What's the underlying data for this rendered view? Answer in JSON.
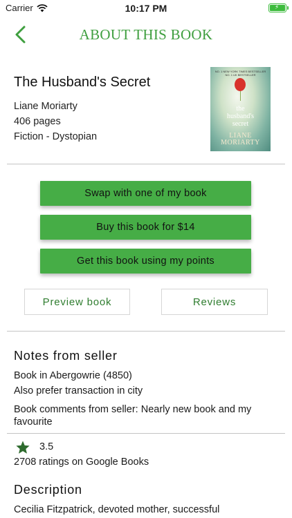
{
  "status_bar": {
    "carrier": "Carrier",
    "time": "10:17 PM"
  },
  "nav": {
    "title": "ABOUT THIS BOOK"
  },
  "book": {
    "title": "The Husband's Secret",
    "author": "Liane Moriarty",
    "pages": "406 pages",
    "genre": "Fiction - Dystopian",
    "cover": {
      "top_text_1": "NO. 1 NEW YORK TIMES BESTSELLER",
      "top_text_2": "NO. 1 UK BESTSELLER",
      "title_1": "the",
      "title_2": "husband's",
      "title_3": "secret",
      "author_1": "LIANE",
      "author_2": "MORIARTY"
    }
  },
  "actions": {
    "swap": "Swap with one of my book",
    "buy": "Buy this book for $14",
    "points": "Get this book using my points",
    "preview": "Preview book",
    "reviews": "Reviews"
  },
  "notes": {
    "heading": "Notes from seller",
    "location": "Book in Abergowrie (4850)",
    "preference": "Also prefer transaction in city",
    "comments": "Book comments from seller: Nearly new book and my favourite"
  },
  "rating": {
    "value": "3.5",
    "count_text": "2708 ratings on Google Books",
    "star_icon": "star-icon"
  },
  "description": {
    "heading": "Description",
    "text": "Cecilia Fitzpatrick, devoted mother, successful"
  },
  "colors": {
    "accent": "#46ad46",
    "title_green": "#3f9f3f",
    "link_green": "#2f7d2f"
  }
}
